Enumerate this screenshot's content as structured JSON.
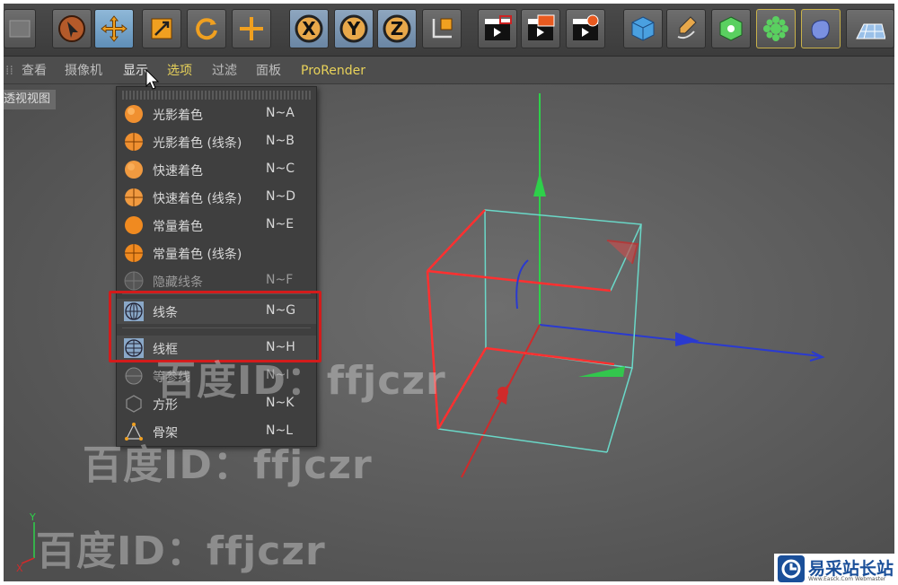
{
  "menubar": {
    "items": [
      "查看",
      "摄像机",
      "显示",
      "选项",
      "过滤",
      "面板",
      "ProRender"
    ]
  },
  "viewport": {
    "label": "透视视图"
  },
  "display_menu": {
    "items": [
      {
        "label": "光影着色",
        "shortcut": "N~A"
      },
      {
        "label": "光影着色 (线条)",
        "shortcut": "N~B"
      },
      {
        "label": "快速着色",
        "shortcut": "N~C"
      },
      {
        "label": "快速着色 (线条)",
        "shortcut": "N~D"
      },
      {
        "label": "常量着色",
        "shortcut": "N~E"
      },
      {
        "label": "常量着色 (线条)",
        "shortcut": ""
      },
      {
        "label": "隐藏线条",
        "shortcut": "N~F"
      },
      {
        "label": "线条",
        "shortcut": "N~G"
      },
      {
        "label": "线框",
        "shortcut": "N~H"
      },
      {
        "label": "等参线",
        "shortcut": "N~I"
      },
      {
        "label": "方形",
        "shortcut": "N~K"
      },
      {
        "label": "骨架",
        "shortcut": "N~L"
      }
    ]
  },
  "toolbar": {
    "axis_x": "X",
    "axis_y": "Y",
    "axis_z": "Z"
  },
  "axis_indicator": {
    "y": "Y",
    "x": "X"
  },
  "watermarks": [
    "百度ID：ffjczr",
    "百度ID：ffjczr",
    "百度ID：ffjczr"
  ],
  "logo": {
    "text": "易采站长站",
    "sub": "Www.Easck.Com  Webmaster"
  },
  "colors": {
    "highlight_box": "#d31b1b",
    "menu_yellow": "#e8d25a",
    "logo_blue": "#1a4f99"
  }
}
